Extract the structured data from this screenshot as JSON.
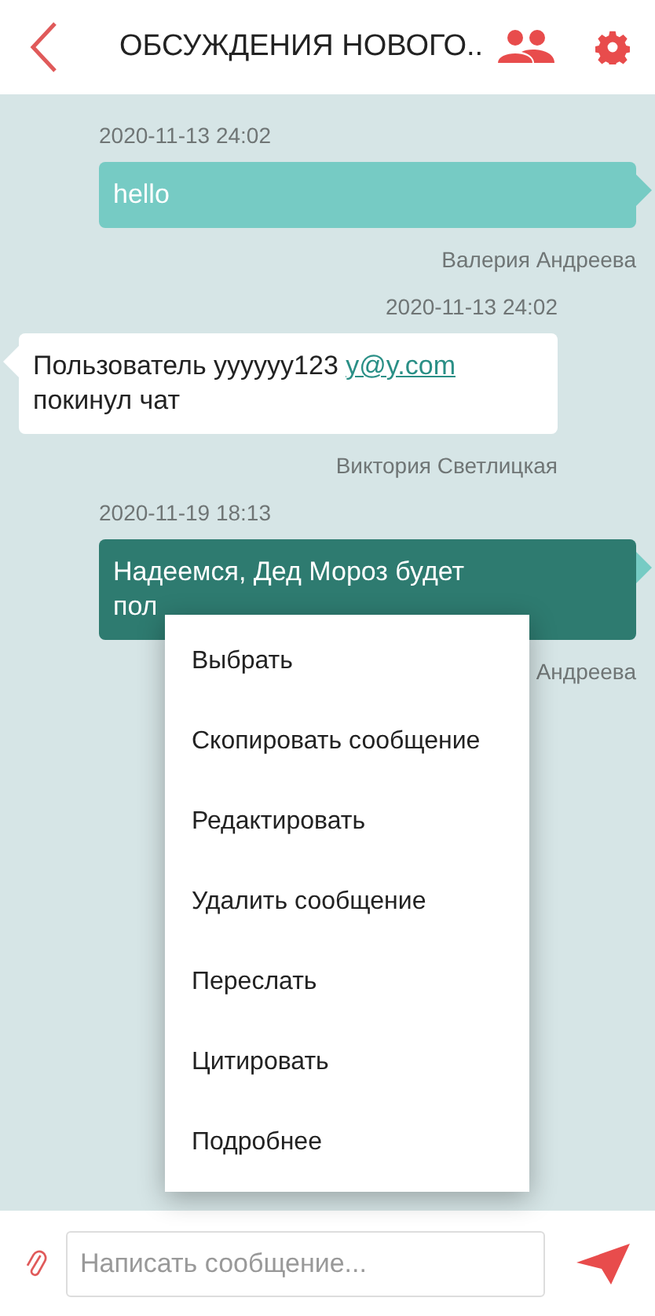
{
  "header": {
    "title": "ОБСУЖДЕНИЯ НОВОГО.."
  },
  "messages": [
    {
      "kind": "outgoing",
      "selected": false,
      "time": "2020-11-13 24:02",
      "lines": [
        "hello"
      ],
      "author": "Валерия Андреева"
    },
    {
      "kind": "incoming",
      "selected": false,
      "time": "2020-11-13 24:02",
      "lines": [
        "Пользователь yyyyyy123 ",
        "покинул чат"
      ],
      "link": "y@y.com",
      "author": "Виктория Светлицкая"
    },
    {
      "kind": "outgoing",
      "selected": true,
      "time": "2020-11-19 18:13",
      "lines": [
        "Надеемся, Дед Мороз будет",
        "пол"
      ],
      "author": "Андреева"
    }
  ],
  "context_menu": {
    "items": [
      "Выбрать",
      "Скопировать сообщение",
      "Редактировать",
      "Удалить сообщение",
      "Переслать",
      "Цитировать",
      "Подробнее"
    ]
  },
  "composer": {
    "placeholder": "Написать сообщение..."
  }
}
